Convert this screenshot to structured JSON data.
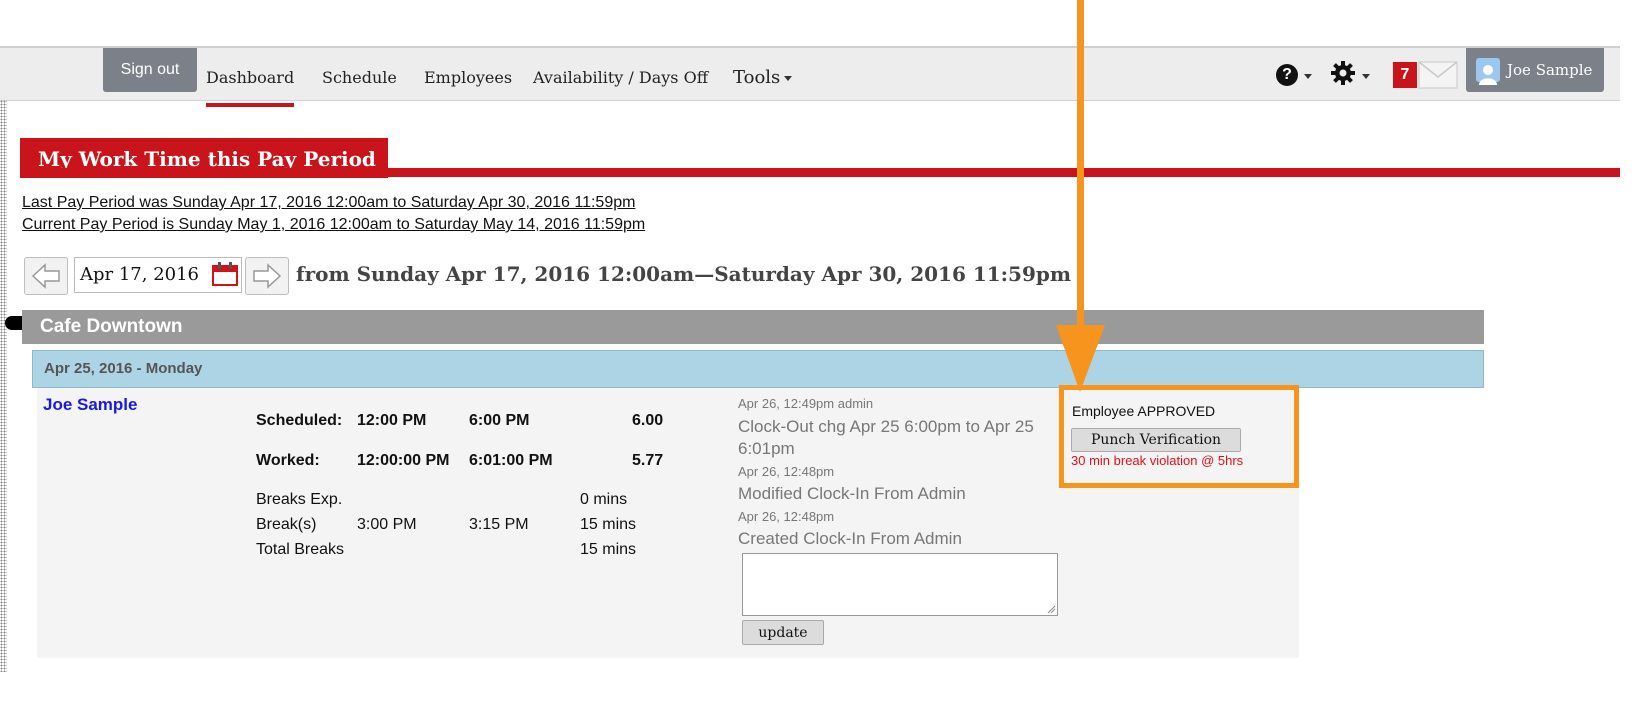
{
  "nav": {
    "signout": "Sign out",
    "items": [
      "Dashboard",
      "Schedule",
      "Employees",
      "Availability / Days Off",
      "Tools"
    ],
    "help_icon": "?",
    "notification_count": "7",
    "user_name": "Joe Sample",
    "active_color": "#c8141a"
  },
  "section": {
    "title": "My Work Time this Pay Period"
  },
  "pay_period": {
    "last_label": "Last Pay Period was ",
    "last_value": "Sunday Apr 17, 2016 12:00am to Saturday Apr 30, 2016 11:59pm",
    "current_label": "Current Pay Period is ",
    "current_value": "Sunday May 1, 2016 12:00am to Saturday May 14, 2016 11:59pm"
  },
  "date_nav": {
    "date_value": "Apr 17, 2016",
    "range_text": "from Sunday Apr 17, 2016 12:00am—Saturday Apr 30, 2016 11:59pm"
  },
  "location": "Cafe Downtown",
  "day_header": "Apr 25, 2016 - Monday",
  "employee": {
    "name": "Joe Sample",
    "scheduled": {
      "label": "Scheduled:",
      "start": "12:00 PM",
      "end": "6:00 PM",
      "hours": "6.00"
    },
    "worked": {
      "label": "Worked:",
      "start": "12:00:00 PM",
      "end": "6:01:00 PM",
      "hours": "5.77"
    },
    "breaks_exp": {
      "label": "Breaks Exp.",
      "value": "0 mins"
    },
    "breaks": {
      "label": "Break(s)",
      "start": "3:00 PM",
      "end": "3:15 PM",
      "value": "15 mins"
    },
    "total_breaks": {
      "label": "Total Breaks",
      "value": "15 mins"
    }
  },
  "log": [
    {
      "meta": "Apr 26, 12:49pm admin",
      "text1": "Clock-Out chg Apr 25 6:00pm to Apr 25",
      "text2": "6:01pm"
    },
    {
      "meta": "Apr 26, 12:48pm",
      "text1": "Modified Clock-In From Admin"
    },
    {
      "meta": "Apr 26, 12:48pm",
      "text1": "Created Clock-In From Admin"
    }
  ],
  "update_button": "update",
  "status": {
    "text": "Employee APPROVED",
    "punch_button": "Punch Verification",
    "violation": "30 min break violation @ 5hrs",
    "highlight_color": "#f7941d"
  }
}
